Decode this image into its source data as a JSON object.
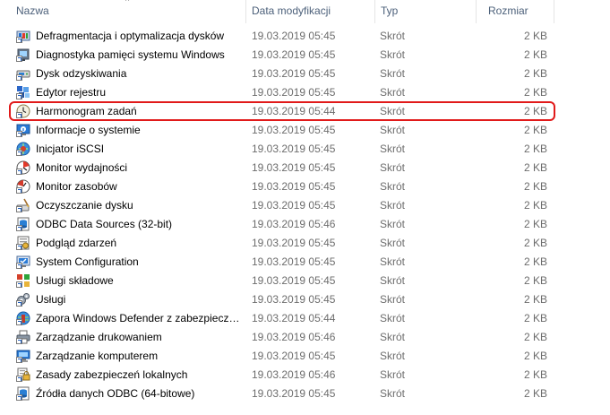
{
  "columns": {
    "name": "Nazwa",
    "date": "Data modyfikacji",
    "type": "Typ",
    "size": "Rozmiar"
  },
  "sort_indicator": "^",
  "highlight_color": "#e11a1a",
  "highlighted_item": "Harmonogram zadań",
  "files": [
    {
      "name": "Defragmentacja i optymalizacja dysków",
      "date": "19.03.2019 05:45",
      "type": "Skrót",
      "size": "2 KB",
      "icon": "defragment-icon"
    },
    {
      "name": "Diagnostyka pamięci systemu Windows",
      "date": "19.03.2019 05:45",
      "type": "Skrót",
      "size": "2 KB",
      "icon": "memory-diagnostics-icon"
    },
    {
      "name": "Dysk odzyskiwania",
      "date": "19.03.2019 05:45",
      "type": "Skrót",
      "size": "2 KB",
      "icon": "recovery-drive-icon"
    },
    {
      "name": "Edytor rejestru",
      "date": "19.03.2019 05:45",
      "type": "Skrót",
      "size": "2 KB",
      "icon": "registry-editor-icon"
    },
    {
      "name": "Harmonogram zadań",
      "date": "19.03.2019 05:44",
      "type": "Skrót",
      "size": "2 KB",
      "icon": "task-scheduler-icon"
    },
    {
      "name": "Informacje o systemie",
      "date": "19.03.2019 05:45",
      "type": "Skrót",
      "size": "2 KB",
      "icon": "system-information-icon"
    },
    {
      "name": "Inicjator iSCSI",
      "date": "19.03.2019 05:45",
      "type": "Skrót",
      "size": "2 KB",
      "icon": "iscsi-initiator-icon"
    },
    {
      "name": "Monitor wydajności",
      "date": "19.03.2019 05:45",
      "type": "Skrót",
      "size": "2 KB",
      "icon": "performance-monitor-icon"
    },
    {
      "name": "Monitor zasobów",
      "date": "19.03.2019 05:45",
      "type": "Skrót",
      "size": "2 KB",
      "icon": "resource-monitor-icon"
    },
    {
      "name": "Oczyszczanie dysku",
      "date": "19.03.2019 05:45",
      "type": "Skrót",
      "size": "2 KB",
      "icon": "disk-cleanup-icon"
    },
    {
      "name": "ODBC Data Sources (32-bit)",
      "date": "19.03.2019 05:46",
      "type": "Skrót",
      "size": "2 KB",
      "icon": "odbc-icon"
    },
    {
      "name": "Podgląd zdarzeń",
      "date": "19.03.2019 05:45",
      "type": "Skrót",
      "size": "2 KB",
      "icon": "event-viewer-icon"
    },
    {
      "name": "System Configuration",
      "date": "19.03.2019 05:45",
      "type": "Skrót",
      "size": "2 KB",
      "icon": "system-configuration-icon"
    },
    {
      "name": "Usługi składowe",
      "date": "19.03.2019 05:45",
      "type": "Skrót",
      "size": "2 KB",
      "icon": "component-services-icon"
    },
    {
      "name": "Usługi",
      "date": "19.03.2019 05:45",
      "type": "Skrót",
      "size": "2 KB",
      "icon": "services-icon"
    },
    {
      "name": "Zapora Windows Defender z zabezpiecze...",
      "date": "19.03.2019 05:44",
      "type": "Skrót",
      "size": "2 KB",
      "icon": "firewall-icon"
    },
    {
      "name": "Zarządzanie drukowaniem",
      "date": "19.03.2019 05:46",
      "type": "Skrót",
      "size": "2 KB",
      "icon": "print-management-icon"
    },
    {
      "name": "Zarządzanie komputerem",
      "date": "19.03.2019 05:45",
      "type": "Skrót",
      "size": "2 KB",
      "icon": "computer-management-icon"
    },
    {
      "name": "Zasady zabezpieczeń lokalnych",
      "date": "19.03.2019 05:46",
      "type": "Skrót",
      "size": "2 KB",
      "icon": "local-security-policy-icon"
    },
    {
      "name": "Źródła danych ODBC (64-bitowe)",
      "date": "19.03.2019 05:45",
      "type": "Skrót",
      "size": "2 KB",
      "icon": "odbc-64-icon"
    }
  ]
}
